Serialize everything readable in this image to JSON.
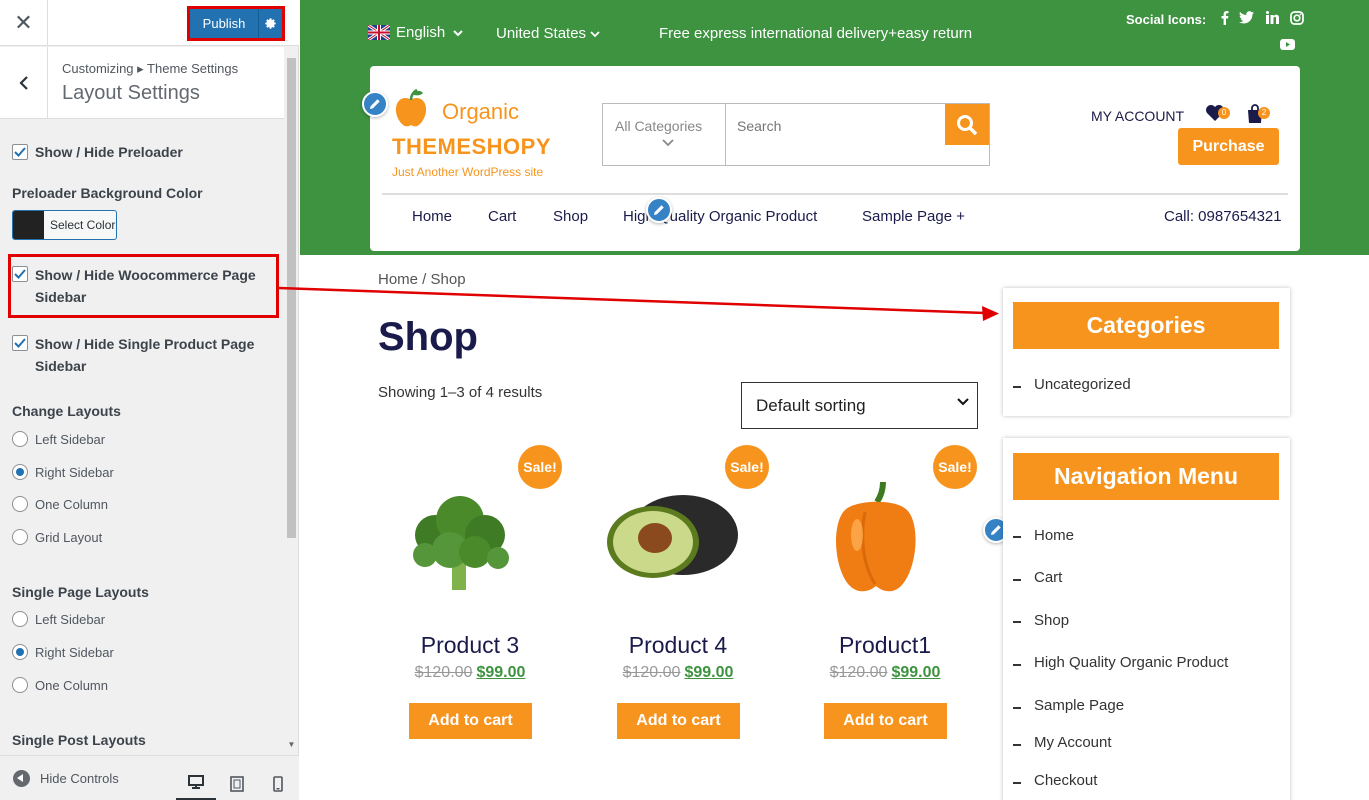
{
  "customizer": {
    "close_label": "✕",
    "publish_label": "Publish",
    "breadcrumb": "Customizing ▸ Theme Settings",
    "section_title": "Layout Settings",
    "preloader_toggle": "Show / Hide Preloader",
    "preloader_bg_label": "Preloader Background Color",
    "select_color_label": "Select Color",
    "swatch_color": "#222222",
    "woo_sidebar_toggle": "Show / Hide Woocommerce Page Sidebar",
    "single_product_toggle": "Show / Hide Single Product Page Sidebar",
    "change_layouts": {
      "label": "Change Layouts",
      "options": [
        "Left Sidebar",
        "Right Sidebar",
        "One Column",
        "Grid Layout"
      ],
      "selected": "Right Sidebar"
    },
    "single_page_layouts": {
      "label": "Single Page Layouts",
      "options": [
        "Left Sidebar",
        "Right Sidebar",
        "One Column"
      ],
      "selected": "Right Sidebar"
    },
    "single_post_label": "Single Post Layouts",
    "hide_controls_label": "Hide Controls",
    "devices": [
      "desktop-icon",
      "tablet-icon",
      "mobile-icon"
    ]
  },
  "site": {
    "colors": {
      "green": "#3d9340",
      "orange": "#f7941d",
      "navy": "#1b1b4b"
    },
    "language": "English",
    "country": "United States",
    "delivery_note": "Free express international delivery+easy return",
    "social_label": "Social Icons:",
    "social": [
      "facebook-icon",
      "twitter-icon",
      "linkedin-icon",
      "instagram-icon",
      "youtube-icon"
    ],
    "logo_top": "Organic",
    "logo_main": "THEMESHOPY",
    "tagline": "Just Another WordPress site",
    "search": {
      "category_label": "All Categories",
      "placeholder": "Search"
    },
    "my_account": "MY ACCOUNT",
    "wishlist_count": "0",
    "cart_count": "2",
    "purchase_label": "Purchase",
    "nav": [
      "Home",
      "Cart",
      "Shop",
      "High Quality Organic Product",
      "Sample Page +"
    ],
    "call": "Call: 0987654321"
  },
  "shop": {
    "breadcrumb": "Home / Shop",
    "title": "Shop",
    "showing": "Showing 1–3 of 4 results",
    "sort_label": "Default sorting",
    "sale_badge": "Sale!",
    "add_to_cart": "Add to cart",
    "products": [
      {
        "name": "Product 3",
        "old_price": "$120.00",
        "price": "$99.00",
        "image": "broccoli"
      },
      {
        "name": "Product 4",
        "old_price": "$120.00",
        "price": "$99.00",
        "image": "avocado"
      },
      {
        "name": "Product1",
        "old_price": "$120.00",
        "price": "$99.00",
        "image": "bell-pepper"
      }
    ]
  },
  "sidebar": {
    "categories_title": "Categories",
    "categories": [
      "Uncategorized"
    ],
    "nav_title": "Navigation Menu",
    "nav_items": [
      "Home",
      "Cart",
      "Shop",
      "High Quality Organic Product",
      "Sample Page",
      "My Account",
      "Checkout"
    ]
  }
}
